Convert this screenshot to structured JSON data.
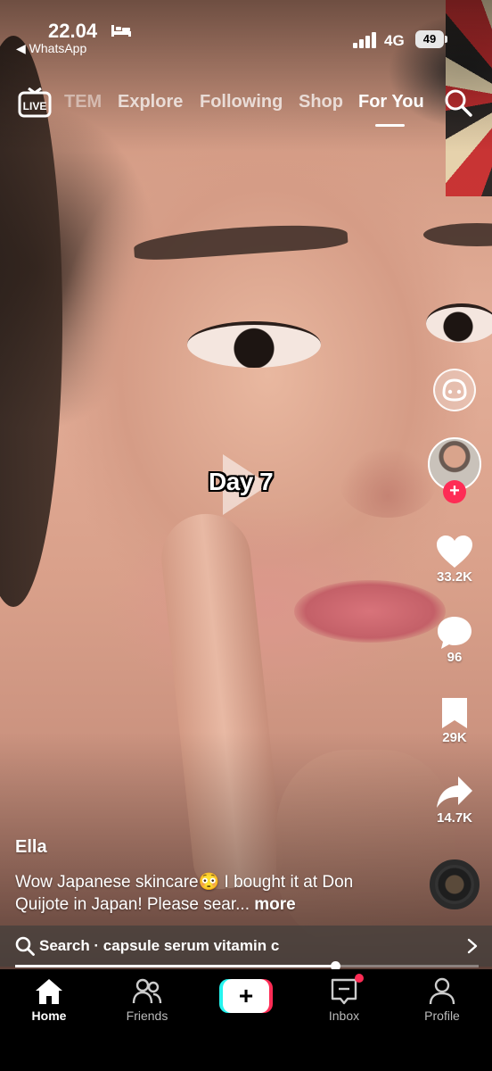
{
  "status_bar": {
    "time": "22.04",
    "back_app": "◀ WhatsApp",
    "network": "4G",
    "battery": "49"
  },
  "top_nav": {
    "tabs": [
      {
        "label": "TEM"
      },
      {
        "label": "Explore"
      },
      {
        "label": "Following"
      },
      {
        "label": "Shop"
      },
      {
        "label": "For You",
        "active": true
      }
    ]
  },
  "video": {
    "overlay_text": "Day 7",
    "author": "Ella",
    "caption": "Wow Japanese skincare😳 I bought it at Don Quijote in Japan! Please sear...",
    "caption_more": " more"
  },
  "actions": {
    "likes": "33.2K",
    "comments": "96",
    "saves": "29K",
    "shares": "14.7K"
  },
  "search_suggestion": {
    "text": "Search · capsule serum vitamin c"
  },
  "playback": {
    "progress": 0.69
  },
  "bottom_nav": {
    "home": "Home",
    "friends": "Friends",
    "inbox": "Inbox",
    "profile": "Profile"
  },
  "colors": {
    "accent_red": "#fe2c55",
    "accent_cyan": "#25f4ee"
  }
}
